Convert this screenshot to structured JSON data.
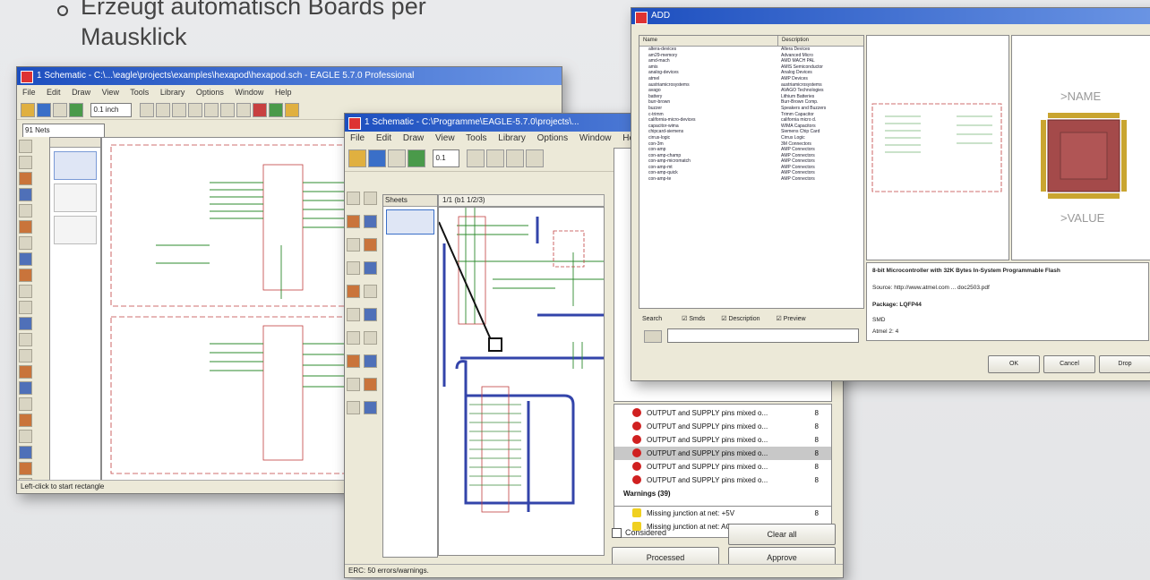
{
  "slide": {
    "bullet_line1": "Erzeugt automatisch Boards per",
    "bullet_line2": "Mausklick"
  },
  "schematic_back": {
    "title": "1 Schematic - C:\\...\\eagle\\projects\\examples\\hexapod\\hexapod.sch - EAGLE 5.7.0 Professional",
    "menu": [
      "File",
      "Edit",
      "Draw",
      "View",
      "Tools",
      "Library",
      "Options",
      "Window",
      "Help"
    ],
    "combo_grid": "0.1 inch",
    "combo_layer": "91 Nets",
    "status": "Left-click to start rectangle"
  },
  "schematic_front": {
    "title": "1 Schematic - C:\\Programme\\EAGLE-5.7.0\\projects\\...",
    "menu": [
      "File",
      "Edit",
      "Draw",
      "View",
      "Tools",
      "Library",
      "Options",
      "Window",
      "Help"
    ],
    "combo_grid": "0.1",
    "sheets_label": "Sheets",
    "sheet_tab": "1/1 (b1 1/2/3)",
    "status": "ERC: 50 errors/warnings."
  },
  "erc": {
    "errors": [
      "OUTPUT and SUPPLY pins mixed o...",
      "OUTPUT and SUPPLY pins mixed o...",
      "OUTPUT and SUPPLY pins mixed o...",
      "OUTPUT and SUPPLY pins mixed o...",
      "OUTPUT and SUPPLY pins mixed o...",
      "OUTPUT and SUPPLY pins mixed o...",
      "OUTPUT and SUPPLY pins mixed o...",
      "OUTPUT and SUPPLY pins mixed o..."
    ],
    "error_count": "8",
    "warnings_header": "Warnings (39)",
    "warnings": [
      "Missing junction at net: +5V",
      "Missing junction at net: ACT"
    ],
    "warning_count": "8",
    "considered_label": "Considered",
    "clear_all_label": "Clear all",
    "processed_label": "Processed",
    "approve_label": "Approve"
  },
  "add_dialog": {
    "title": "ADD",
    "col_name": "Name",
    "col_description": "Description",
    "libraries": [
      [
        "altera-devices",
        "Altera Devices"
      ],
      [
        "am29-memory",
        "Advanced Micro"
      ],
      [
        "amd-mach",
        "AMD MACH PAL"
      ],
      [
        "amis",
        "AMIS Semiconductor"
      ],
      [
        "analog-devices",
        "Analog Devices"
      ],
      [
        "atmel",
        "AMP Devices"
      ],
      [
        "austriamicrosystems",
        "austriamicrosystems"
      ],
      [
        "avago",
        "AVAGO Technologies"
      ],
      [
        "battery",
        "Lithium Batteries"
      ],
      [
        "burr-brown",
        "Burr-Brown Comp."
      ],
      [
        "buzzer",
        "Speakers and Buzzers"
      ],
      [
        "c-trimm",
        "Trimm Capacitor"
      ],
      [
        "california-micro-devices",
        "california micro d."
      ],
      [
        "capacitor-wima",
        "WIMA Capacitors"
      ],
      [
        "chipcard-siemens",
        "Siemens Chip Card"
      ],
      [
        "cirrus-logic",
        "Cirrus Logic"
      ],
      [
        "con-3m",
        "3M Connectors"
      ],
      [
        "con-amp",
        "AMP Connectors"
      ],
      [
        "con-amp-champ",
        "AMP Connectors"
      ],
      [
        "con-amp-micromatch",
        "AMP Connectors"
      ],
      [
        "con-amp-mt",
        "AMP Connectors"
      ],
      [
        "con-amp-quick",
        "AMP Connectors"
      ],
      [
        "con-amp-te",
        "AMP Connectors"
      ]
    ],
    "search_label": "Search",
    "check_smds": "Smds",
    "check_description": "Description",
    "check_preview": "Preview",
    "symbol_name": ">NAME",
    "symbol_value": ">VALUE",
    "info_title": "8-bit Microcontroller with 32K Bytes In-System Programmable Flash",
    "info_source": "Source: http://www.atmel.com ... doc2503.pdf",
    "info_package": "Package: LQFP44",
    "info_smd": "SMD",
    "info_heading": "Atmel 2: 4",
    "ok_label": "OK",
    "cancel_label": "Cancel",
    "drop_label": "Drop"
  },
  "colors": {
    "title_blue": "#1d4fbf",
    "erc_error": "#d02020",
    "net_green": "#2e8b2e",
    "bus_blue": "#3344aa",
    "pad_brown": "#a44a4a"
  }
}
